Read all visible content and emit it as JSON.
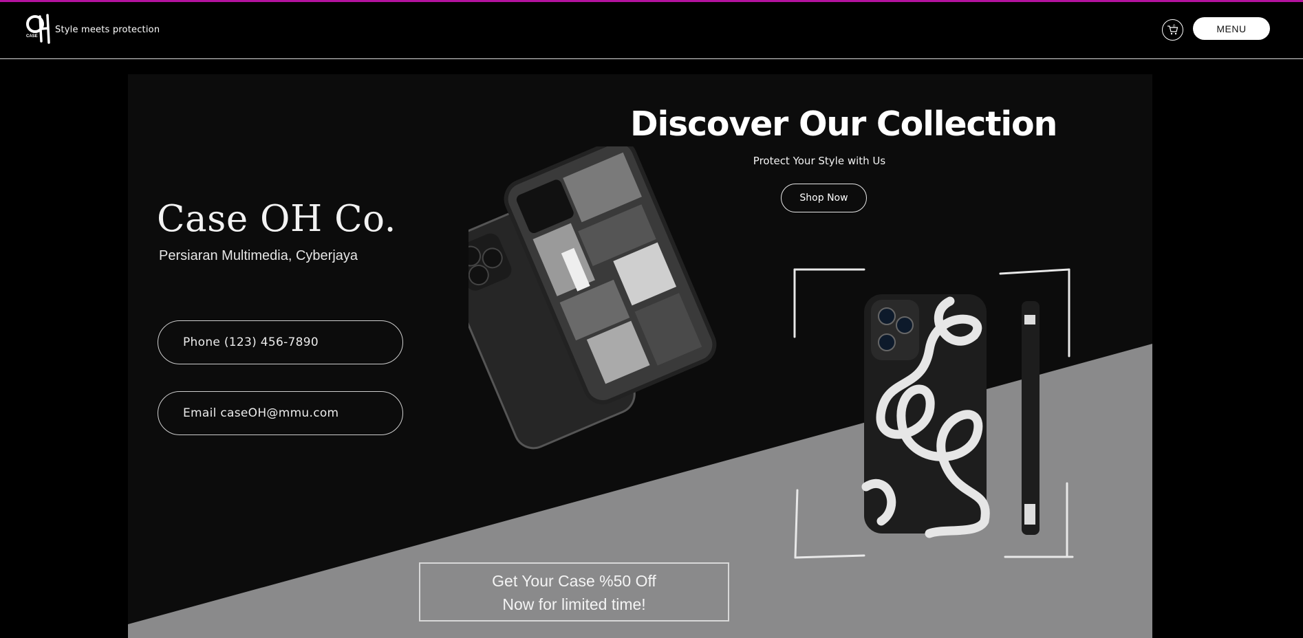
{
  "header": {
    "logo_text": "OH CASE",
    "tagline": "Style meets protection",
    "cart_count": "0",
    "menu_label": "MENU"
  },
  "contact": {
    "brand": "Case OH Co.",
    "address": "Persiaran Multimedia, Cyberjaya",
    "phone": "Phone (123) 456-7890",
    "email": "Email caseOH@mmu.com"
  },
  "hero": {
    "title": "Discover Our Collection",
    "subtitle": "Protect Your Style with Us",
    "cta": "Shop Now"
  },
  "promo": {
    "line1": "Get Your Case %50 Off",
    "line2": "Now for limited time!"
  },
  "colors": {
    "accent_line": "#b3129e",
    "background": "#000000",
    "hero_bg": "#0c0c0c",
    "diagonal": "#8a8a8b"
  }
}
